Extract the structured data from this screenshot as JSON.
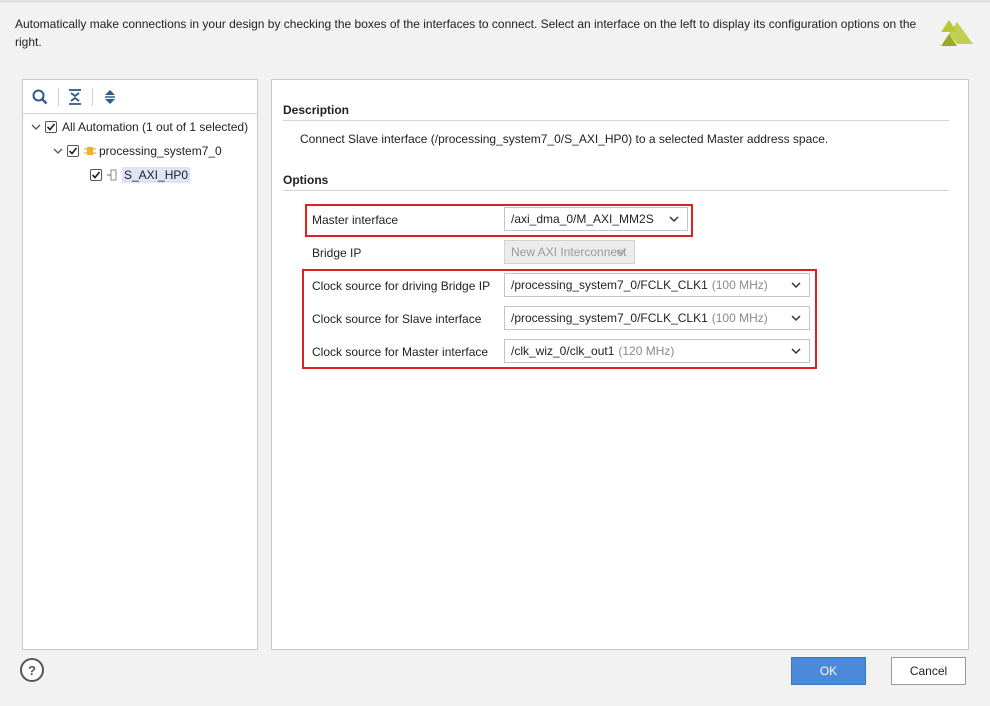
{
  "header": {
    "text": "Automatically make connections in your design by checking the boxes of the interfaces to connect. Select an interface on the left to display its configuration options on the right."
  },
  "toolbar": {
    "icons": [
      "search-icon",
      "collapse-all-icon",
      "expand-all-icon"
    ]
  },
  "tree": {
    "root_label": "All Automation (1 out of 1 selected)",
    "child_label": "processing_system7_0",
    "leaf_label": "S_AXI_HP0"
  },
  "right": {
    "description_title": "Description",
    "description_text": "Connect Slave interface (/processing_system7_0/S_AXI_HP0) to a selected Master address space.",
    "options_title": "Options",
    "options": [
      {
        "label": "Master interface",
        "value": "/axi_dma_0/M_AXI_MM2S",
        "freq": "",
        "disabled": false
      },
      {
        "label": "Bridge IP",
        "value": "New AXI Interconnect",
        "freq": "",
        "disabled": true
      },
      {
        "label": "Clock source for driving Bridge IP",
        "value": "/processing_system7_0/FCLK_CLK1",
        "freq": "(100 MHz)",
        "disabled": false
      },
      {
        "label": "Clock source for Slave interface",
        "value": "/processing_system7_0/FCLK_CLK1",
        "freq": "(100 MHz)",
        "disabled": false
      },
      {
        "label": "Clock source for Master interface",
        "value": "/clk_wiz_0/clk_out1",
        "freq": "(120 MHz)",
        "disabled": false
      }
    ]
  },
  "footer": {
    "help_label": "?",
    "ok_label": "OK",
    "cancel_label": "Cancel"
  },
  "colors": {
    "accent": "#4a8ad8",
    "highlight": "#e02020",
    "logo": "#b9c832"
  }
}
